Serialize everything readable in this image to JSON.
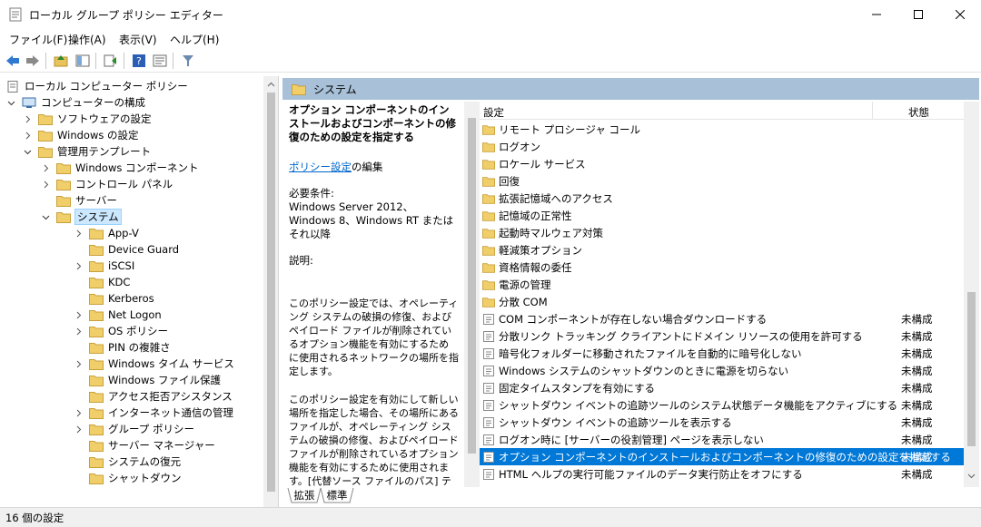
{
  "window": {
    "title": "ローカル グループ ポリシー エディター"
  },
  "menu": [
    "ファイル(F)",
    "操作(A)",
    "表示(V)",
    "ヘルプ(H)"
  ],
  "toolbar_icons": [
    "back-icon",
    "forward-icon",
    "up-folder-icon",
    "show-hide-tree-icon",
    "export-list-icon",
    "help-icon",
    "properties-icon",
    "filter-icon"
  ],
  "tree": {
    "root": "ローカル コンピューター ポリシー",
    "computer_config": "コンピューターの構成",
    "software_settings": "ソフトウェアの設定",
    "windows_settings": "Windows の設定",
    "admin_templates": "管理用テンプレート",
    "items_level3": [
      "Windows コンポーネント",
      "コントロール パネル",
      "サーバー",
      "システム"
    ],
    "system_children": [
      "App-V",
      "Device Guard",
      "iSCSI",
      "KDC",
      "Kerberos",
      "Net Logon",
      "OS ポリシー",
      "PIN の複雑さ",
      "Windows タイム サービス",
      "Windows ファイル保護",
      "アクセス拒否アシスタンス",
      "インターネット通信の管理",
      "グループ ポリシー",
      "サーバー マネージャー",
      "システムの復元",
      "シャットダウン"
    ]
  },
  "header": {
    "section": "システム"
  },
  "description": {
    "title": "オプション コンポーネントのインストールおよびコンポーネントの修復のための設定を指定する",
    "edit_link": "ポリシー設定",
    "edit_suffix": "の編集",
    "requirements_label": "必要条件:",
    "requirements": "Windows Server 2012、Windows 8、Windows RT またはそれ以降",
    "explain_label": "説明:",
    "para1": "このポリシー設定では、オペレーティング システムの破損の修復、およびペイロード ファイルが削除されているオプション機能を有効にするために使用されるネットワークの場所を指定します。",
    "para2": "このポリシー設定を有効にして新しい場所を指定した場合、その場所にあるファイルが、オペレーティング システムの破損の修復、およびペイロード ファイルが削除されているオプション機能を有効にするために使用されます。[代替ソース ファイルのパス] テキスト ボックスに新しい場所への完全修飾パスを入力する必要があります。複数の場所はセミコロンで区切る"
  },
  "list": {
    "col_setting": "設定",
    "col_state": "状態",
    "folders": [
      "リモート プロシージャ コール",
      "ログオン",
      "ロケール サービス",
      "回復",
      "拡張記憶域へのアクセス",
      "記憶域の正常性",
      "起動時マルウェア対策",
      "軽減策オプション",
      "資格情報の委任",
      "電源の管理",
      "分散 COM"
    ],
    "settings": [
      {
        "name": "COM コンポーネントが存在しない場合ダウンロードする",
        "state": "未構成"
      },
      {
        "name": "分散リンク トラッキング クライアントにドメイン リソースの使用を許可する",
        "state": "未構成"
      },
      {
        "name": "暗号化フォルダーに移動されたファイルを自動的に暗号化しない",
        "state": "未構成"
      },
      {
        "name": "Windows システムのシャットダウンのときに電源を切らない",
        "state": "未構成"
      },
      {
        "name": "固定タイムスタンプを有効にする",
        "state": "未構成"
      },
      {
        "name": "シャットダウン イベントの追跡ツールのシステム状態データ機能をアクティブにする",
        "state": "未構成"
      },
      {
        "name": "シャットダウン イベントの追跡ツールを表示する",
        "state": "未構成"
      },
      {
        "name": "ログオン時に [サーバーの役割管理] ページを表示しない",
        "state": "未構成"
      },
      {
        "name": "オプション コンポーネントのインストールおよびコンポーネントの修復のための設定を指定する",
        "state": "未構成"
      },
      {
        "name": "HTML ヘルプの実行可能ファイルのデータ実行防止をオフにする",
        "state": "未構成"
      }
    ]
  },
  "tabs": [
    "拡張",
    "標準"
  ],
  "status": "16 個の設定",
  "colors": {
    "selection": "#0078d7",
    "header_band": "#a8c0d8",
    "folder": "#e8c25a"
  }
}
